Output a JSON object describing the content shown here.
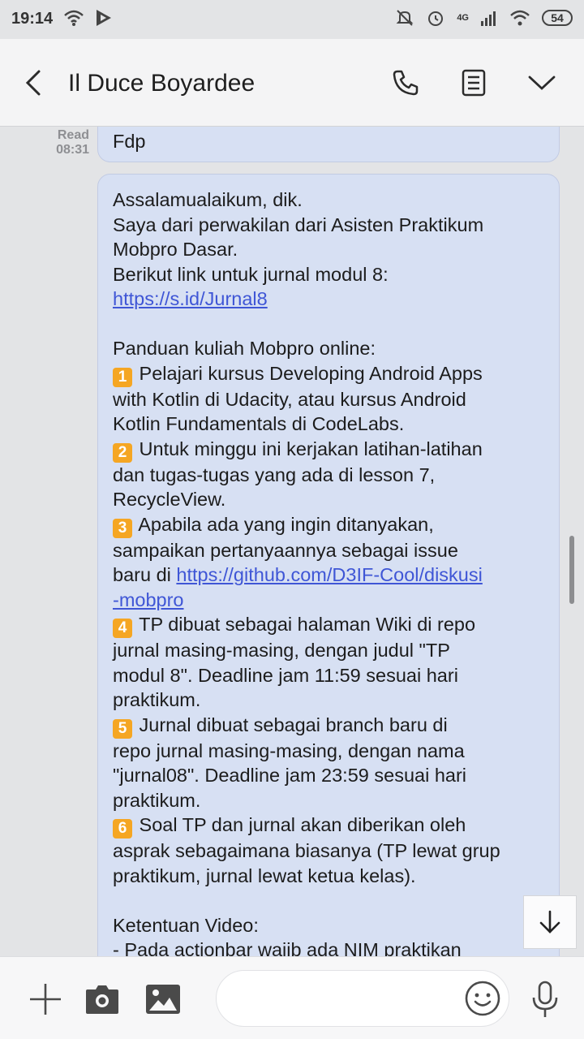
{
  "status_bar": {
    "time": "19:14",
    "network": "4G",
    "battery": "54"
  },
  "header": {
    "title": "Il Duce Boyardee"
  },
  "messages": [
    {
      "meta_status": "Read",
      "meta_time": "08:31",
      "text": "Fdp"
    },
    {
      "p1": "Assalamualaikum, dik.\nSaya dari perwakilan dari Asisten Praktikum\nMobpro Dasar.\nBerikut link untuk jurnal modul 8:\n",
      "link1": "https://s.id/Jurnal8",
      "p2": "\n\nPanduan kuliah Mobpro online:\n",
      "items": [
        {
          "num": "1",
          "text": " Pelajari kursus Developing Android Apps\nwith Kotlin di Udacity, atau kursus Android\nKotlin Fundamentals di CodeLabs.\n"
        },
        {
          "num": "2",
          "text": " Untuk minggu ini kerjakan latihan-latihan\ndan tugas-tugas yang ada di lesson 7,\nRecycleView.\n"
        },
        {
          "num": "3",
          "text": " Apabila ada yang ingin ditanyakan,\nsampaikan pertanyaannya sebagai issue\nbaru di "
        }
      ],
      "link2": "https://github.com/D3IF-Cool/diskusi\n-mobpro",
      "items2": [
        {
          "num": "4",
          "text": " TP dibuat sebagai halaman Wiki di repo\njurnal masing-masing, dengan judul \"TP\nmodul 8\". Deadline jam 11:59 sesuai hari\npraktikum.\n"
        },
        {
          "num": "5",
          "text": " Jurnal dibuat sebagai branch baru di\nrepo jurnal masing-masing, dengan nama\n\"jurnal08\". Deadline jam 23:59 sesuai hari\npraktikum.\n"
        },
        {
          "num": "6",
          "text": " Soal TP dan jurnal akan diberikan oleh\nasprak sebagaimana biasanya (TP lewat grup\npraktikum, jurnal lewat ketua kelas).\n"
        }
      ],
      "p3": "\nKetentuan Video:\n- Pada actionbar wajib ada NIM praktikan"
    }
  ],
  "input": {
    "placeholder": ""
  },
  "icons": {
    "back": "back-arrow-icon",
    "call": "phone-icon",
    "notes": "notes-icon",
    "menu": "chevron-down-icon",
    "add": "plus-icon",
    "camera": "camera-icon",
    "gallery": "image-icon",
    "emoji": "emoji-icon",
    "mic": "microphone-icon",
    "scroll_down": "arrow-down-icon"
  },
  "colors": {
    "bubble": "#d7e0f3",
    "link": "#3f56d6",
    "number_badge": "#f5a623"
  }
}
